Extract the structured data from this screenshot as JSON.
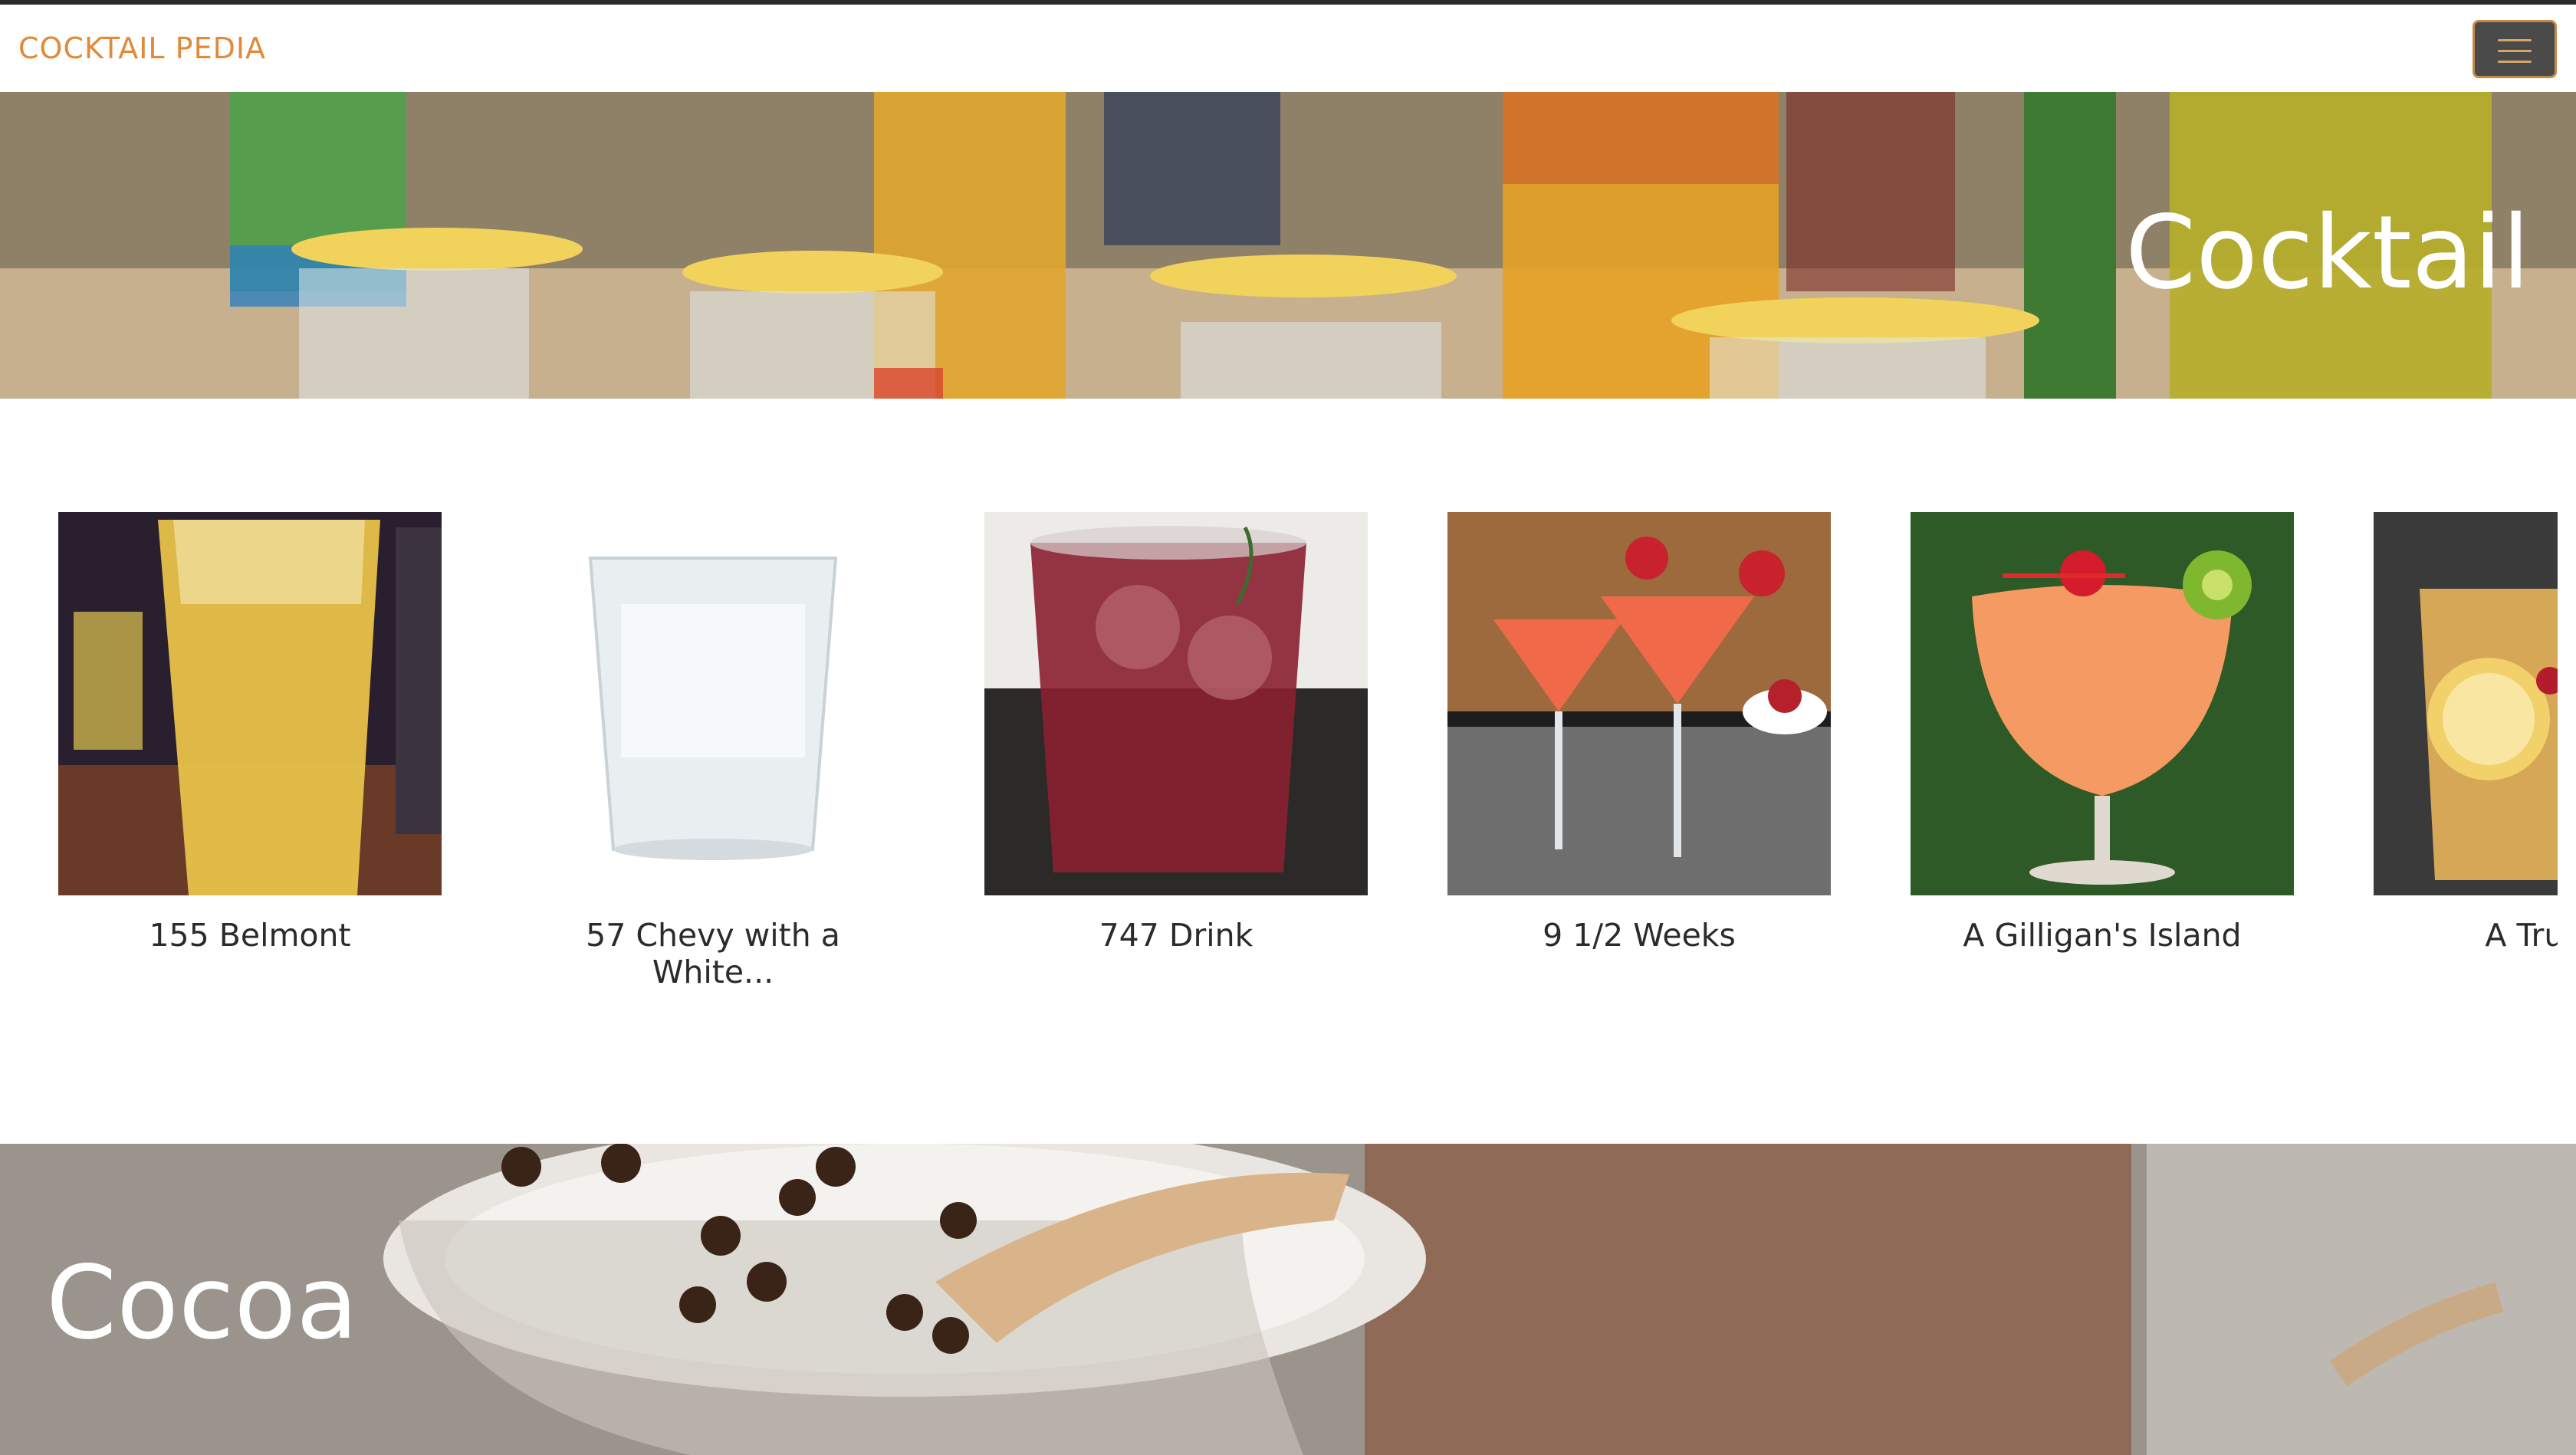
{
  "navbar": {
    "brand": "COCKTAIL PEDIA",
    "menu_icon": "hamburger-icon"
  },
  "sections": {
    "cocktail": {
      "title": "Cocktail"
    },
    "cocoa": {
      "title": "Cocoa"
    }
  },
  "drinks": [
    {
      "name": "155 Belmont"
    },
    {
      "name": "57 Chevy with a White..."
    },
    {
      "name": "747 Drink"
    },
    {
      "name": "9 1/2 Weeks"
    },
    {
      "name": "A Gilligan's Island"
    },
    {
      "name": "A True Am"
    }
  ],
  "colors": {
    "brand": "#e08a3a",
    "menu_button": "#4a4a4a",
    "menu_border": "#c78a45"
  }
}
